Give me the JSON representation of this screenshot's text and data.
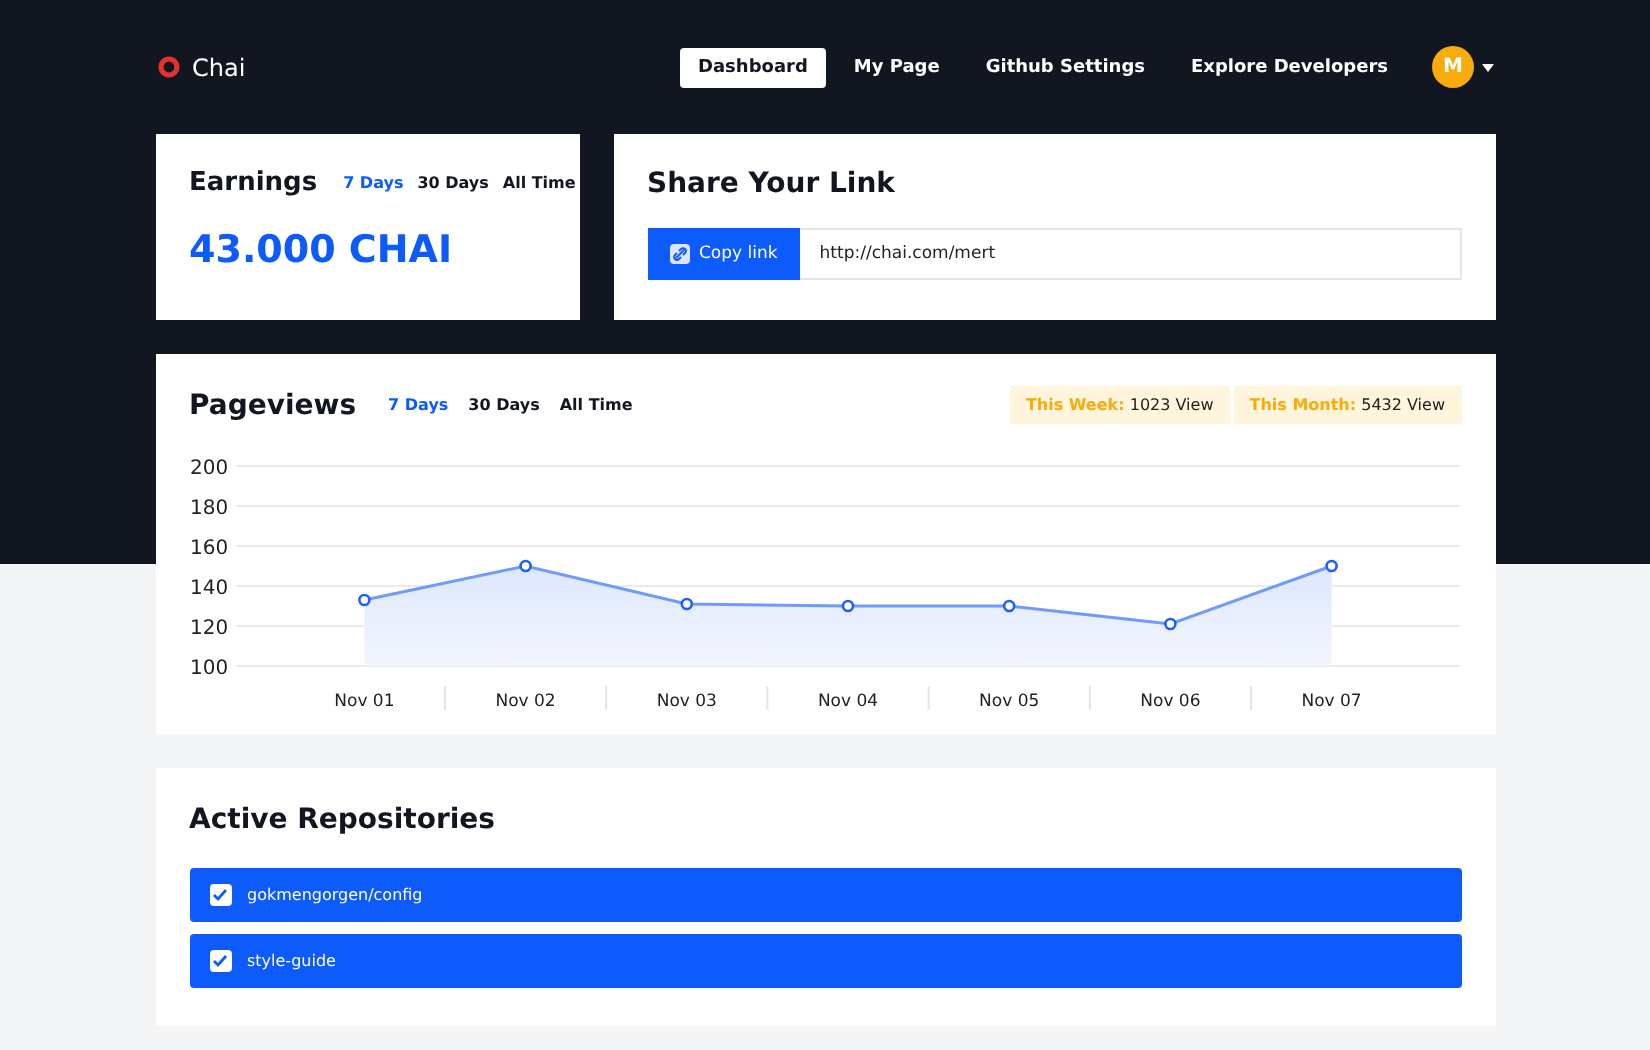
{
  "brand": {
    "name": "Chai"
  },
  "nav": [
    {
      "label": "Dashboard",
      "selected": true
    },
    {
      "label": "My Page",
      "selected": false
    },
    {
      "label": "Github Settings",
      "selected": false
    },
    {
      "label": "Explore Developers",
      "selected": false
    }
  ],
  "avatar": {
    "initial": "M"
  },
  "earnings": {
    "title": "Earnings",
    "ranges": [
      {
        "label": "7 Days",
        "selected": true
      },
      {
        "label": "30 Days",
        "selected": false
      },
      {
        "label": "All Time",
        "selected": false
      }
    ],
    "amount": "43.000 CHAI"
  },
  "share": {
    "title": "Share Your Link",
    "button": "Copy link",
    "value": "http://chai.com/mert"
  },
  "pageviews": {
    "title": "Pageviews",
    "ranges": [
      {
        "label": "7 Days",
        "selected": true
      },
      {
        "label": "30 Days",
        "selected": false
      },
      {
        "label": "All Time",
        "selected": false
      }
    ],
    "stats": [
      {
        "label": "This Week:",
        "value": "1023 View"
      },
      {
        "label": "This Month:",
        "value": "5432 View"
      }
    ],
    "chart_data": {
      "type": "area",
      "categories": [
        "Nov 01",
        "Nov 02",
        "Nov 03",
        "Nov 04",
        "Nov 05",
        "Nov 06",
        "Nov 07"
      ],
      "grid": true,
      "series": [
        {
          "color": "#6f9bfb",
          "values": [
            133,
            150,
            131,
            130,
            130,
            121,
            150
          ]
        }
      ],
      "ylim": [
        100,
        200
      ],
      "yticks": [
        100,
        120,
        140,
        160,
        180,
        200
      ]
    }
  },
  "repositories": {
    "title": "Active Repositories",
    "items": [
      {
        "name": "gokmengorgen/config",
        "checked": true
      },
      {
        "name": "style-guide",
        "checked": true
      }
    ]
  }
}
